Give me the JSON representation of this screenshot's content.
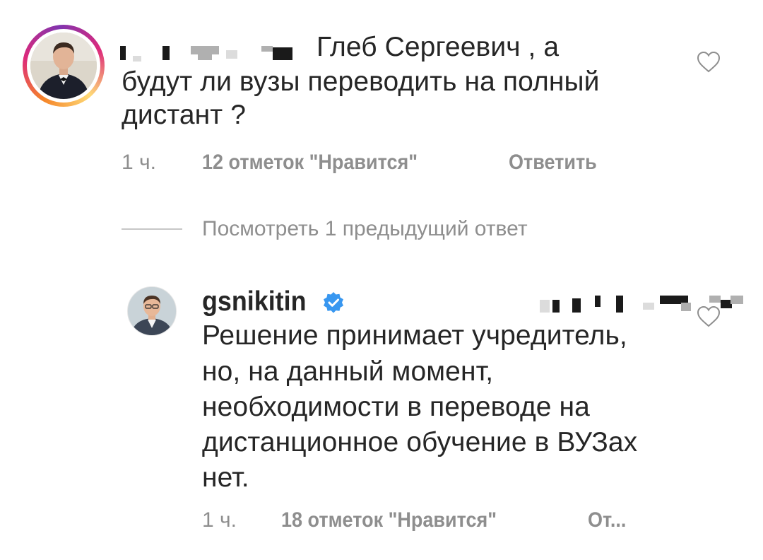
{
  "top_comment": {
    "username_suffix": "Глеб Сергеевич , а",
    "text_lines": [
      "будут ли вузы переводить на полный",
      "дистант ?"
    ],
    "time": "1 ч.",
    "likes": "12 отметок \"Нравится\"",
    "reply_label": "Ответить"
  },
  "view_replies_label": "Посмотреть 1 предыдущий ответ",
  "reply_comment": {
    "username": "gsnikitin",
    "text_lines": [
      "Решение принимает учредитель,",
      "но, на данный момент,",
      "необходимости в переводе на",
      "дистанционное обучение в ВУЗах",
      "нет."
    ],
    "time": "1 ч.",
    "likes": "18 отметок \"Нравится\"",
    "reply_label": "От..."
  },
  "icons": {
    "like": "heart-outline-icon",
    "verified": "verified-badge-icon"
  },
  "colors": {
    "text": "#262626",
    "secondary": "#8e8e8e",
    "verified_blue": "#3897f0"
  }
}
